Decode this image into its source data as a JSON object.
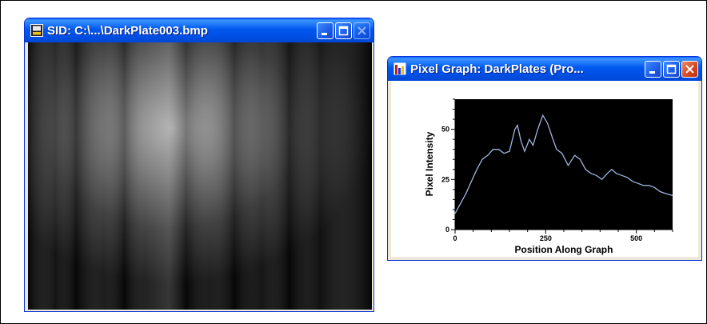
{
  "sid_window": {
    "title": "SID: C:\\...\\DarkPlate003.bmp"
  },
  "graph_window": {
    "title": "Pixel Graph: DarkPlates (Pro..."
  },
  "colors": {
    "titlebar": "#0054e3",
    "close_button": "#d9431a",
    "plot_background": "#000000",
    "plot_line": "#9fb5e0"
  },
  "chart_data": {
    "type": "line",
    "title": "",
    "xlabel": "Position Along Graph",
    "ylabel": "Pixel Intensity",
    "xlim": [
      0,
      600
    ],
    "ylim": [
      0,
      65
    ],
    "xticks": [
      0,
      250,
      500
    ],
    "yticks": [
      0,
      25,
      50
    ],
    "grid": false,
    "series": [
      {
        "values": [
          [
            0,
            8
          ],
          [
            15,
            13
          ],
          [
            30,
            18
          ],
          [
            45,
            24
          ],
          [
            60,
            30
          ],
          [
            75,
            35
          ],
          [
            90,
            37
          ],
          [
            105,
            40
          ],
          [
            120,
            40
          ],
          [
            135,
            38
          ],
          [
            150,
            39
          ],
          [
            165,
            50
          ],
          [
            172,
            52
          ],
          [
            182,
            44
          ],
          [
            192,
            39
          ],
          [
            205,
            45
          ],
          [
            215,
            42
          ],
          [
            228,
            50
          ],
          [
            242,
            57
          ],
          [
            255,
            53
          ],
          [
            268,
            46
          ],
          [
            280,
            40
          ],
          [
            295,
            38
          ],
          [
            312,
            32
          ],
          [
            330,
            37
          ],
          [
            345,
            35
          ],
          [
            360,
            30
          ],
          [
            375,
            28
          ],
          [
            390,
            27
          ],
          [
            405,
            25
          ],
          [
            420,
            28
          ],
          [
            432,
            30
          ],
          [
            445,
            28
          ],
          [
            460,
            27
          ],
          [
            475,
            26
          ],
          [
            490,
            24
          ],
          [
            505,
            23
          ],
          [
            520,
            22
          ],
          [
            535,
            22
          ],
          [
            550,
            21
          ],
          [
            565,
            19
          ],
          [
            580,
            18
          ],
          [
            600,
            17
          ]
        ]
      }
    ]
  }
}
